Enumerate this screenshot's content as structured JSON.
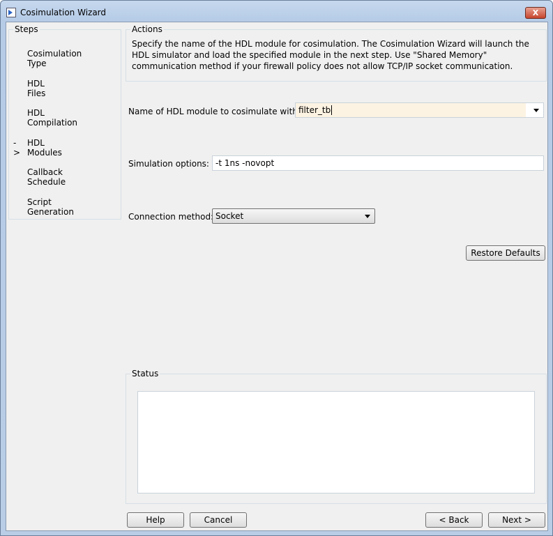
{
  "window": {
    "title": "Cosimulation Wizard",
    "close_label": "X"
  },
  "steps": {
    "legend": "Steps",
    "current_marker": "->",
    "items": [
      {
        "label": "Cosimulation Type"
      },
      {
        "label": "HDL Files"
      },
      {
        "label": "HDL Compilation"
      },
      {
        "label": "HDL Modules",
        "current": true
      },
      {
        "label": "Callback Schedule"
      },
      {
        "label": "Script Generation"
      }
    ]
  },
  "actions": {
    "legend": "Actions",
    "description": "Specify the name of the HDL module for cosimulation. The Cosimulation Wizard will launch the HDL simulator and load the specified module in the next step. Use \"Shared Memory\" communication method if your firewall policy does not allow  TCP/IP socket communication."
  },
  "form": {
    "module_label": "Name of HDL module to cosimulate with:",
    "module_value": "filter_tb",
    "sim_label": "Simulation options:",
    "sim_value": "-t 1ns -novopt",
    "conn_label": "Connection method:",
    "conn_value": "Socket",
    "restore_label": "Restore Defaults"
  },
  "status": {
    "legend": "Status",
    "text": ""
  },
  "footer": {
    "help": "Help",
    "cancel": "Cancel",
    "back": "< Back",
    "next": "Next >"
  }
}
